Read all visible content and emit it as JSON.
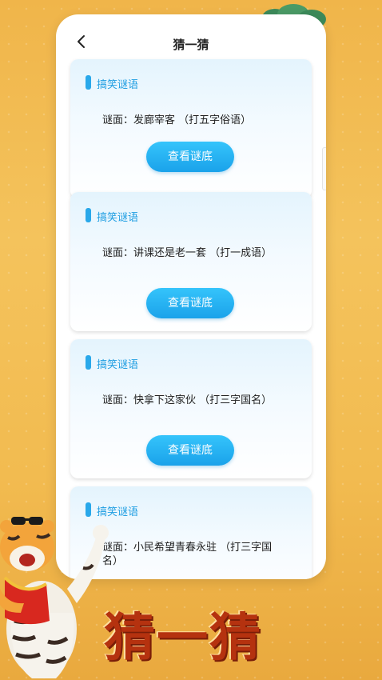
{
  "nav": {
    "title": "猜一猜"
  },
  "cards": [
    {
      "tag": "搞笑谜语",
      "riddle": "谜面：发廊宰客 （打五字俗语）",
      "button": "查看谜底"
    },
    {
      "tag": "搞笑谜语",
      "riddle": "谜面：讲课还是老一套 （打一成语）",
      "button": "查看谜底"
    },
    {
      "tag": "搞笑谜语",
      "riddle": "谜面：快拿下这家伙 （打三字国名）",
      "button": "查看谜底"
    },
    {
      "tag": "搞笑谜语",
      "riddle": "谜面：小民希望青春永驻 （打三字国名）"
    }
  ],
  "banner": {
    "title": "猜一猜"
  },
  "icons": {
    "back": "chevron-left-icon"
  },
  "colors": {
    "accent": "#1aa2ea",
    "tag": "#1f9ee2",
    "background": "#f2bb50",
    "banner_text": "#b5320f"
  }
}
